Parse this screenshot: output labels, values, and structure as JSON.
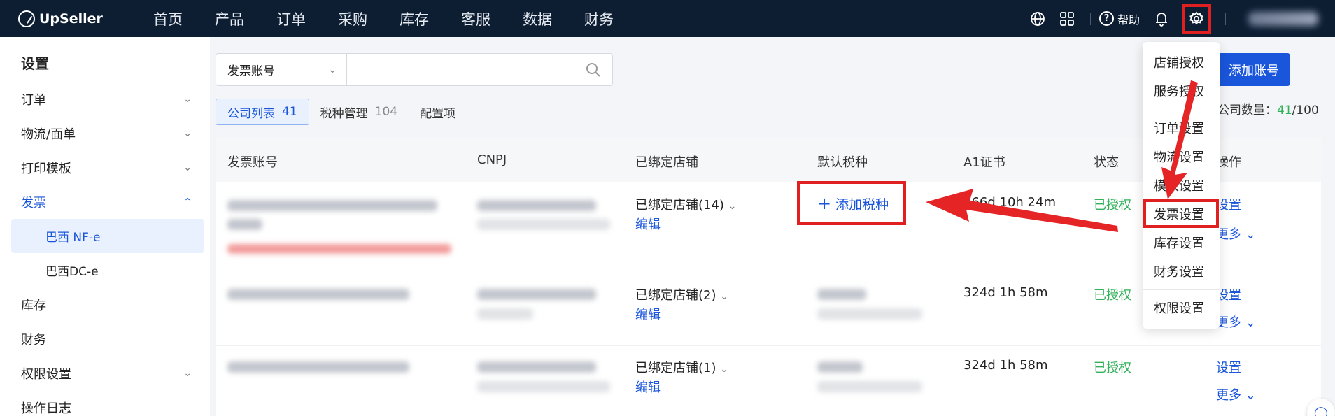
{
  "app": {
    "brand": "UpSeller"
  },
  "nav": [
    "首页",
    "产品",
    "订单",
    "采购",
    "库存",
    "客服",
    "数据",
    "财务"
  ],
  "topbar": {
    "help_label": "帮助"
  },
  "sidebar": {
    "title": "设置",
    "items": [
      {
        "label": "订单",
        "chevron": "v"
      },
      {
        "label": "物流/面单",
        "chevron": "v"
      },
      {
        "label": "打印模板",
        "chevron": "v"
      },
      {
        "label": "发票",
        "chevron": "^"
      },
      {
        "label": "巴西 NF-e"
      },
      {
        "label": "巴西DC-e"
      },
      {
        "label": "库存"
      },
      {
        "label": "财务"
      },
      {
        "label": "权限设置",
        "chevron": "v"
      },
      {
        "label": "操作日志"
      }
    ]
  },
  "search": {
    "select_label": "发票账号"
  },
  "tabs": [
    {
      "label": "公司列表",
      "count": "41"
    },
    {
      "label": "税种管理",
      "count": "104"
    },
    {
      "label": "配置项",
      "count": ""
    }
  ],
  "table": {
    "headers": [
      "发票账号",
      "CNPJ",
      "已绑定店铺",
      "默认税种",
      "A1证书",
      "状态",
      "操作"
    ],
    "rows": [
      {
        "stores": "已绑定店铺(14)",
        "edit": "编辑",
        "tax_action": "添加税种",
        "cert": "366d 10h 24m",
        "status": "已授权",
        "op1": "设置",
        "op2": "更多"
      },
      {
        "stores": "已绑定店铺(2)",
        "edit": "编辑",
        "cert": "324d 1h 58m",
        "status": "已授权",
        "op1": "设置",
        "op2": "更多"
      },
      {
        "stores": "已绑定店铺(1)",
        "edit": "编辑",
        "cert": "324d 1h 58m",
        "status": "已授权",
        "op1": "设置",
        "op2": "更多"
      }
    ]
  },
  "actions": {
    "add_account": "添加账号",
    "company_count_label": "公司数量：",
    "company_count": "41",
    "company_limit": "/100"
  },
  "menu": [
    "店铺授权",
    "服务授权",
    "订单设置",
    "物流设置",
    "模板设置",
    "发票设置",
    "库存设置",
    "财务设置",
    "权限设置"
  ],
  "colors": {
    "nav_bg": "#0d1e33",
    "accent": "#1a56db",
    "success": "#32b15a",
    "annotation": "#e02020"
  }
}
